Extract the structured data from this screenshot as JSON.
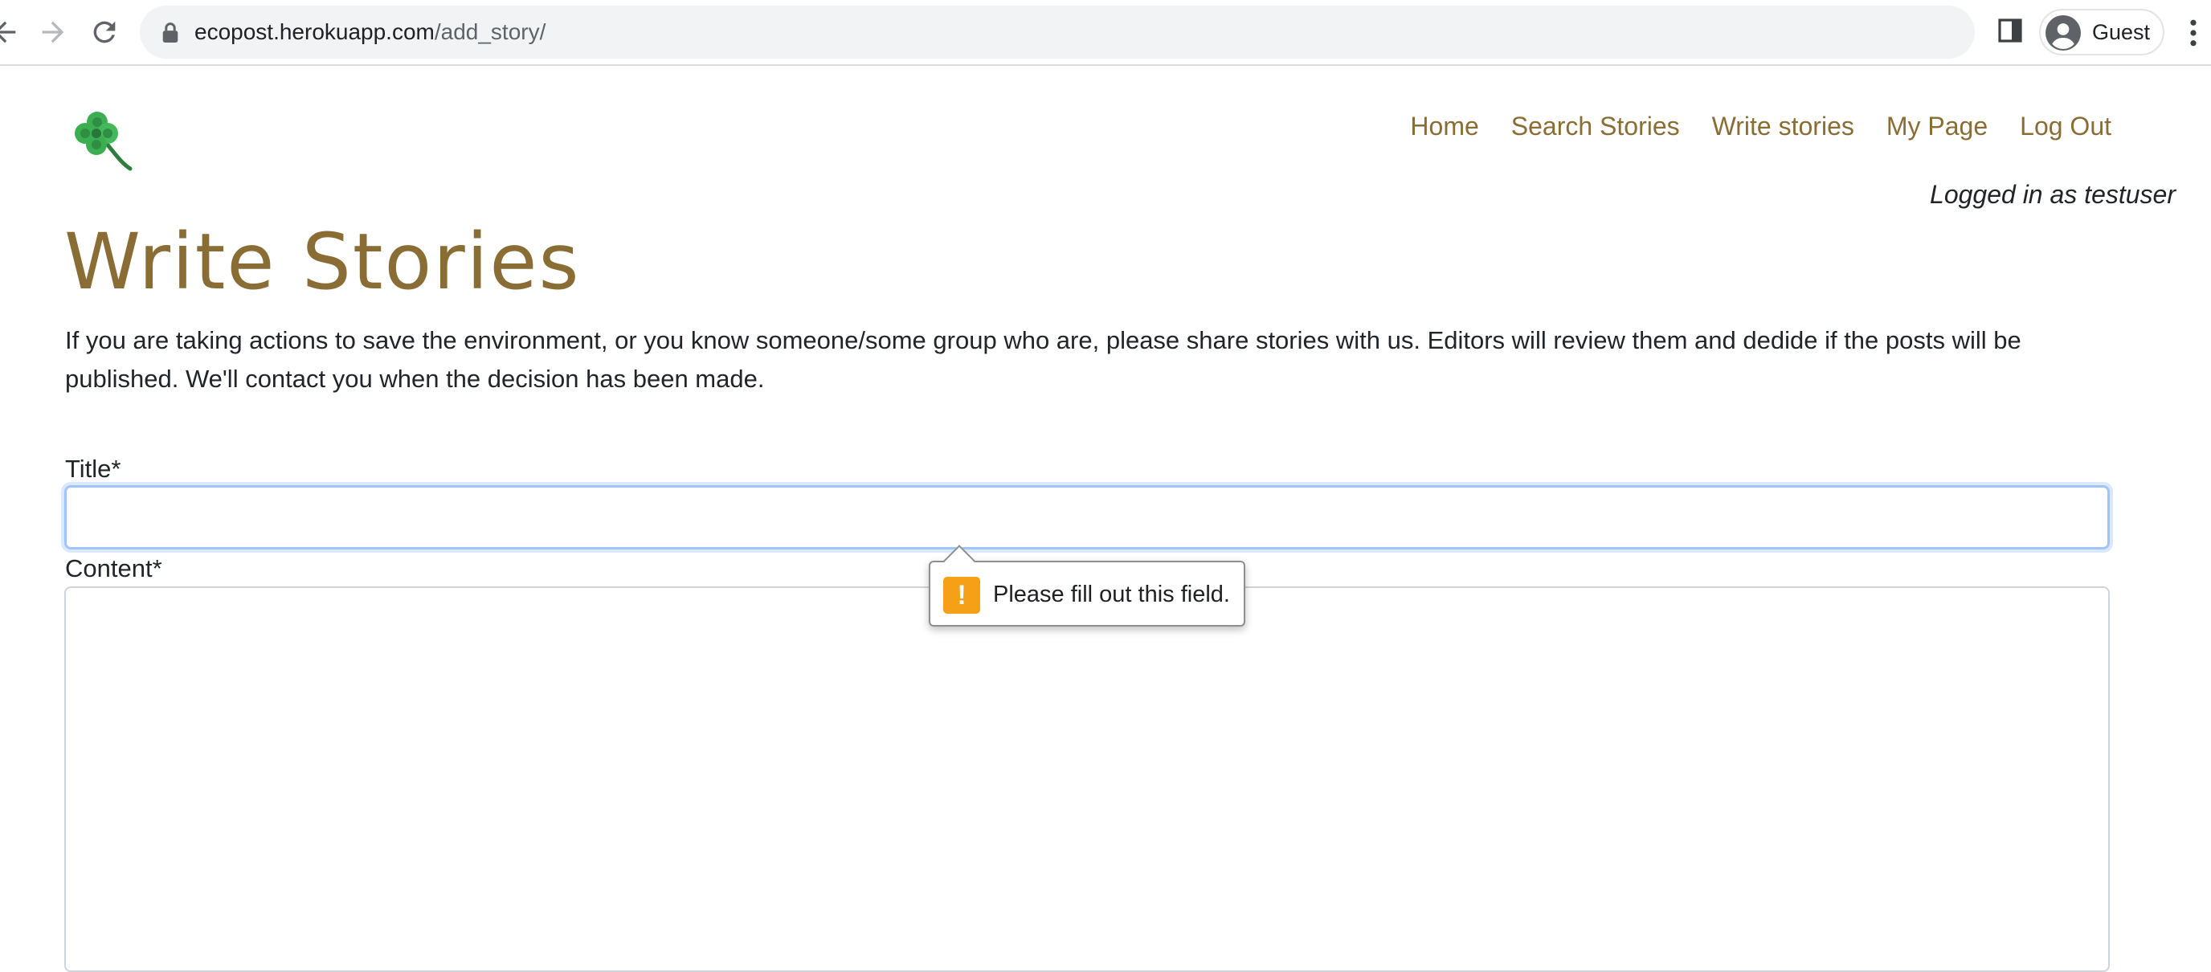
{
  "browser": {
    "url_host": "ecopost.herokuapp.com",
    "url_path": "/add_story/",
    "profile_name": "Guest"
  },
  "nav": {
    "items": [
      {
        "label": "Home"
      },
      {
        "label": "Search Stories"
      },
      {
        "label": "Write stories"
      },
      {
        "label": "My Page"
      },
      {
        "label": "Log Out"
      }
    ],
    "link_color": "#8a6d35"
  },
  "user_status": "Logged in as testuser",
  "page": {
    "title": "Write Stories",
    "intro": "If you are taking actions to save the environment, or you know someone/some group who are, please share stories with us. Editors will review them and dedide if the posts will be published. We'll contact you when the decision has been made."
  },
  "form": {
    "title_label": "Title*",
    "title_value": "",
    "content_label": "Content*",
    "content_value": ""
  },
  "validation": {
    "icon": "warning-icon",
    "icon_glyph": "!",
    "message": "Please fill out this field."
  }
}
